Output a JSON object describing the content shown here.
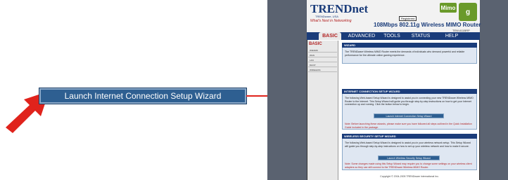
{
  "callout": {
    "button_label": "Launch Internet Connection Setup Wizard"
  },
  "header": {
    "logo": "TRENDnet",
    "logo_sub1": "TRENDware, USA",
    "logo_sub2": "What's Next in Networking",
    "registered": "Registered",
    "product": "108Mbps 802.11g Wireless MIMO Router",
    "model": "TEW-611BRP",
    "badge_mimo": "Mimo",
    "badge_g": "g"
  },
  "nav": {
    "tabs": [
      "BASIC",
      "ADVANCED",
      "TOOLS",
      "STATUS",
      "HELP"
    ]
  },
  "sidebar": {
    "heading": "BASIC",
    "items": [
      "WIZARD",
      "WAN",
      "LAN",
      "DHCP",
      "WIRELESS"
    ]
  },
  "panels": {
    "wizard": {
      "title": "WIZARD",
      "text": "The TRENDware Wireless MIMO Router meets the demands of individuals who demand powerful and reliable performance for the ultimate online gaming experience."
    },
    "internet": {
      "title": "INTERNET CONNECTION SETUP WIZARD",
      "text": "The following Web-based Setup Wizard is designed to assist you in connecting your new TRENDware Wireless MIMO Router to the Internet. This Setup Wizard will guide you through step-by-step instructions on how to get your Internet connection up and running. Click the button below to begin.",
      "button": "Launch Internet Connection Setup Wizard",
      "note": "Note: Before launching these wizards, please make sure you have followed all steps outlined in the Quick Installation Guide included in the package."
    },
    "wireless": {
      "title": "WIRELESS SECURITY SETUP WIZARD",
      "text": "The following Web-based Setup Wizard is designed to assist you in your wireless network setup. This Setup Wizard will guide you through step-by-step instructions on how to set up your wireless network and how to make it secure.",
      "button": "Launch Wireless Security Setup Wizard",
      "note": "Note: Some changes made using this Setup Wizard may require you to change some settings on your wireless client adapters so they can still connect to the TRENDware Wireless MIMO Router."
    }
  },
  "footer": "Copyright © 2004-2005 TRENDware International Inc.",
  "colors": {
    "nav_blue": "#1a3c7a",
    "button_blue": "#2e5f91",
    "arrow_red": "#e0231c"
  }
}
